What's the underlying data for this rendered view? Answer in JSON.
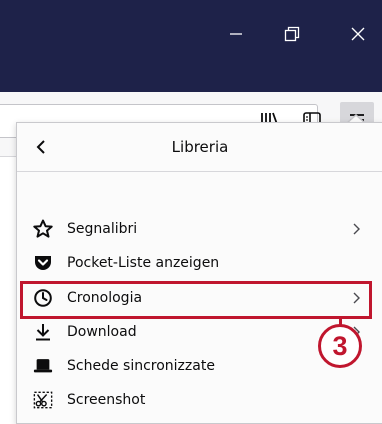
{
  "window": {
    "minimize_icon": "minimize-icon",
    "restore_icon": "restore-icon",
    "close_icon": "close-icon"
  },
  "toolbar": {
    "library_icon": "library-icon",
    "sidebar_icon": "sidebar-icon",
    "menu_icon": "hamburger-menu-icon"
  },
  "panel": {
    "title": "Libreria",
    "back_icon": "chevron-left-icon",
    "items": [
      {
        "label": "Segnalibri",
        "icon": "star-icon",
        "has_submenu": true
      },
      {
        "label": "Pocket-Liste anzeigen",
        "icon": "pocket-icon",
        "has_submenu": false
      },
      {
        "label": "Cronologia",
        "icon": "clock-icon",
        "has_submenu": true
      },
      {
        "label": "Download",
        "icon": "download-icon",
        "has_submenu": true
      },
      {
        "label": "Schede sincronizzate",
        "icon": "synced-tabs-icon",
        "has_submenu": false
      },
      {
        "label": "Screenshot",
        "icon": "screenshot-icon",
        "has_submenu": false
      }
    ]
  },
  "annotation": {
    "step_number": "3",
    "color": "#c0162e"
  },
  "colors": {
    "titlebar": "#1e2249",
    "toolbar": "#f7f7f8",
    "panel": "#fbfbfb"
  }
}
